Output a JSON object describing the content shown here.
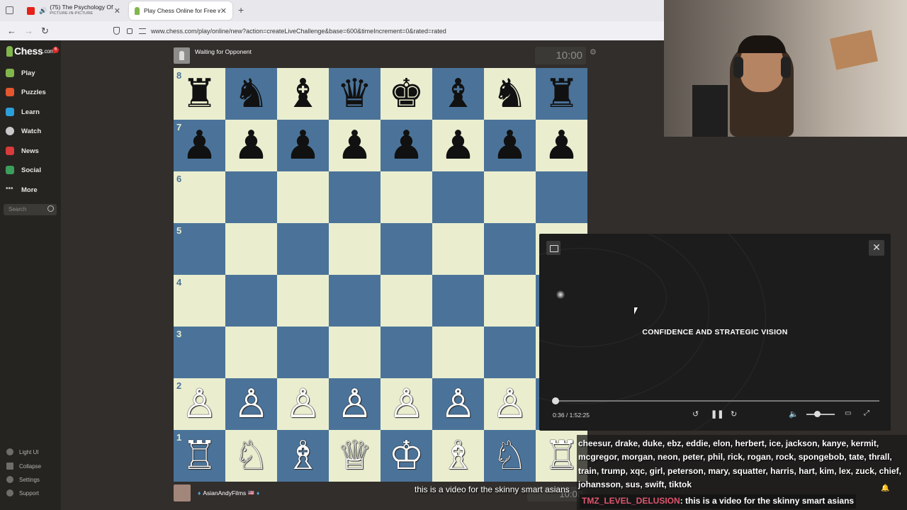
{
  "browser": {
    "tabs": [
      {
        "title": "(75) The Psychology Of Che",
        "subtitle": "PICTURE-IN-PICTURE"
      },
      {
        "title": "Play Chess Online for Free with"
      }
    ],
    "url": "www.chess.com/play/online/new?action=createLiveChallenge&base=600&timeIncrement=0&rated=rated"
  },
  "sidebar": {
    "logo": "Chess",
    "logo_suffix": ".com",
    "notification_count": "6",
    "items": [
      {
        "label": "Play",
        "color": "#81b64c"
      },
      {
        "label": "Puzzles",
        "color": "#e4572e"
      },
      {
        "label": "Learn",
        "color": "#2c9fd9"
      },
      {
        "label": "Watch",
        "color": "#c9c9c9"
      },
      {
        "label": "News",
        "color": "#d93a3a"
      },
      {
        "label": "Social",
        "color": "#3b9e5c"
      },
      {
        "label": "More",
        "color": "#bdbdbd"
      }
    ],
    "search_placeholder": "Search",
    "bottom": [
      "Light UI",
      "Collapse",
      "Settings",
      "Support"
    ]
  },
  "game": {
    "top_player": "Waiting for Opponent",
    "top_clock": "10:00",
    "bottom_player": "AsianAndyFilms",
    "bottom_flag": "🇺🇸",
    "bottom_clock": "10:00",
    "ranks": [
      "8",
      "7",
      "6",
      "5",
      "4",
      "3",
      "2",
      "1"
    ],
    "board": [
      [
        "♜",
        "♞",
        "♝",
        "♛",
        "♚",
        "♝",
        "♞",
        "♜"
      ],
      [
        "♟",
        "♟",
        "♟",
        "♟",
        "♟",
        "♟",
        "♟",
        "♟"
      ],
      [
        "",
        "",
        "",
        "",
        "",
        "",
        "",
        ""
      ],
      [
        "",
        "",
        "",
        "",
        "",
        "",
        "",
        ""
      ],
      [
        "",
        "",
        "",
        "",
        "",
        "",
        "",
        ""
      ],
      [
        "",
        "",
        "",
        "",
        "",
        "",
        "",
        ""
      ],
      [
        "♙",
        "♙",
        "♙",
        "♙",
        "♙",
        "♙",
        "♙",
        ""
      ],
      [
        "♖",
        "♘",
        "♗",
        "♕",
        "♔",
        "♗",
        "♘",
        "♖"
      ]
    ]
  },
  "video": {
    "title": "CONFIDENCE AND STRATEGIC VISION",
    "time": "0:36 / 1:52:25",
    "caption": "this is a video for the skinny smart asians"
  },
  "chat": {
    "names_text": "cheesur, drake, duke, ebz, eddie, elon, herbert, ice, jackson, kanye, kermit, mcgregor, morgan, neon, peter, phil, rick, rogan, rock, spongebob, tate, thrall, train, trump, xqc, girl, peterson, mary, squatter, harris, hart, kim, lex, zuck, chief, johansson, sus, swift, tiktok",
    "user": "TMZ_LEVEL_DELUSION",
    "message": ": this is a video for the skinny smart asians"
  }
}
